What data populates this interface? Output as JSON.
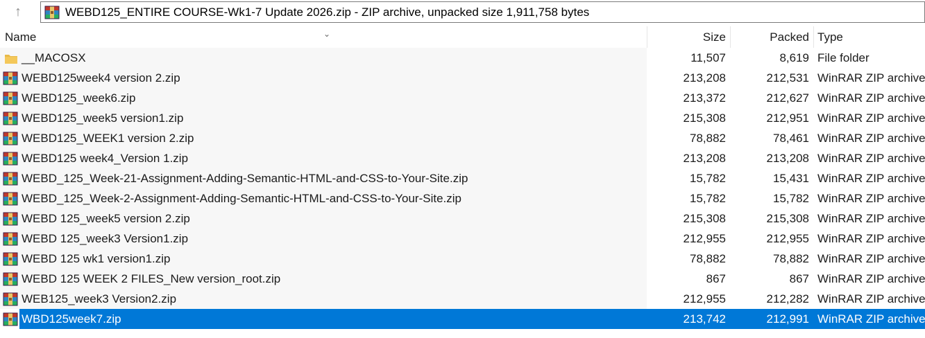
{
  "path_bar": {
    "up_icon": "up-arrow-icon",
    "archive_icon": "winrar-archive-icon",
    "text": "WEBD125_ENTIRE COURSE-Wk1-7 Update 2026.zip - ZIP archive, unpacked size 1,911,758 bytes"
  },
  "columns": {
    "name": "Name",
    "size": "Size",
    "packed": "Packed",
    "type": "Type"
  },
  "rows": [
    {
      "name": "__MACOSX",
      "size": "11,507",
      "packed": "8,619",
      "type": "File folder",
      "icon": "folder-icon"
    },
    {
      "name": "WEBD125week4 version 2.zip",
      "size": "213,208",
      "packed": "212,531",
      "type": "WinRAR ZIP archive",
      "icon": "winrar-archive-icon"
    },
    {
      "name": "WEBD125_week6.zip",
      "size": "213,372",
      "packed": "212,627",
      "type": "WinRAR ZIP archive",
      "icon": "winrar-archive-icon"
    },
    {
      "name": "WEBD125_week5 version1.zip",
      "size": "215,308",
      "packed": "212,951",
      "type": "WinRAR ZIP archive",
      "icon": "winrar-archive-icon"
    },
    {
      "name": "WEBD125_WEEK1 version 2.zip",
      "size": "78,882",
      "packed": "78,461",
      "type": "WinRAR ZIP archive",
      "icon": "winrar-archive-icon"
    },
    {
      "name": "WEBD125 week4_Version 1.zip",
      "size": "213,208",
      "packed": "213,208",
      "type": "WinRAR ZIP archive",
      "icon": "winrar-archive-icon"
    },
    {
      "name": "WEBD_125_Week-21-Assignment-Adding-Semantic-HTML-and-CSS-to-Your-Site.zip",
      "size": "15,782",
      "packed": "15,431",
      "type": "WinRAR ZIP archive",
      "icon": "winrar-archive-icon"
    },
    {
      "name": "WEBD_125_Week-2-Assignment-Adding-Semantic-HTML-and-CSS-to-Your-Site.zip",
      "size": "15,782",
      "packed": "15,782",
      "type": "WinRAR ZIP archive",
      "icon": "winrar-archive-icon"
    },
    {
      "name": "WEBD 125_week5 version 2.zip",
      "size": "215,308",
      "packed": "215,308",
      "type": "WinRAR ZIP archive",
      "icon": "winrar-archive-icon"
    },
    {
      "name": "WEBD 125_week3 Version1.zip",
      "size": "212,955",
      "packed": "212,955",
      "type": "WinRAR ZIP archive",
      "icon": "winrar-archive-icon"
    },
    {
      "name": "WEBD 125 wk1 version1.zip",
      "size": "78,882",
      "packed": "78,882",
      "type": "WinRAR ZIP archive",
      "icon": "winrar-archive-icon"
    },
    {
      "name": "WEBD 125 WEEK 2 FILES_New version_root.zip",
      "size": "867",
      "packed": "867",
      "type": "WinRAR ZIP archive",
      "icon": "winrar-archive-icon"
    },
    {
      "name": "WEB125_week3 Version2.zip",
      "size": "212,955",
      "packed": "212,282",
      "type": "WinRAR ZIP archive",
      "icon": "winrar-archive-icon"
    },
    {
      "name": "WBD125week7.zip",
      "size": "213,742",
      "packed": "212,991",
      "type": "WinRAR ZIP archive",
      "icon": "winrar-archive-icon",
      "selected": true
    }
  ],
  "colors": {
    "selection": "#0078d7",
    "name_column_bg": "#f7f7f7"
  }
}
